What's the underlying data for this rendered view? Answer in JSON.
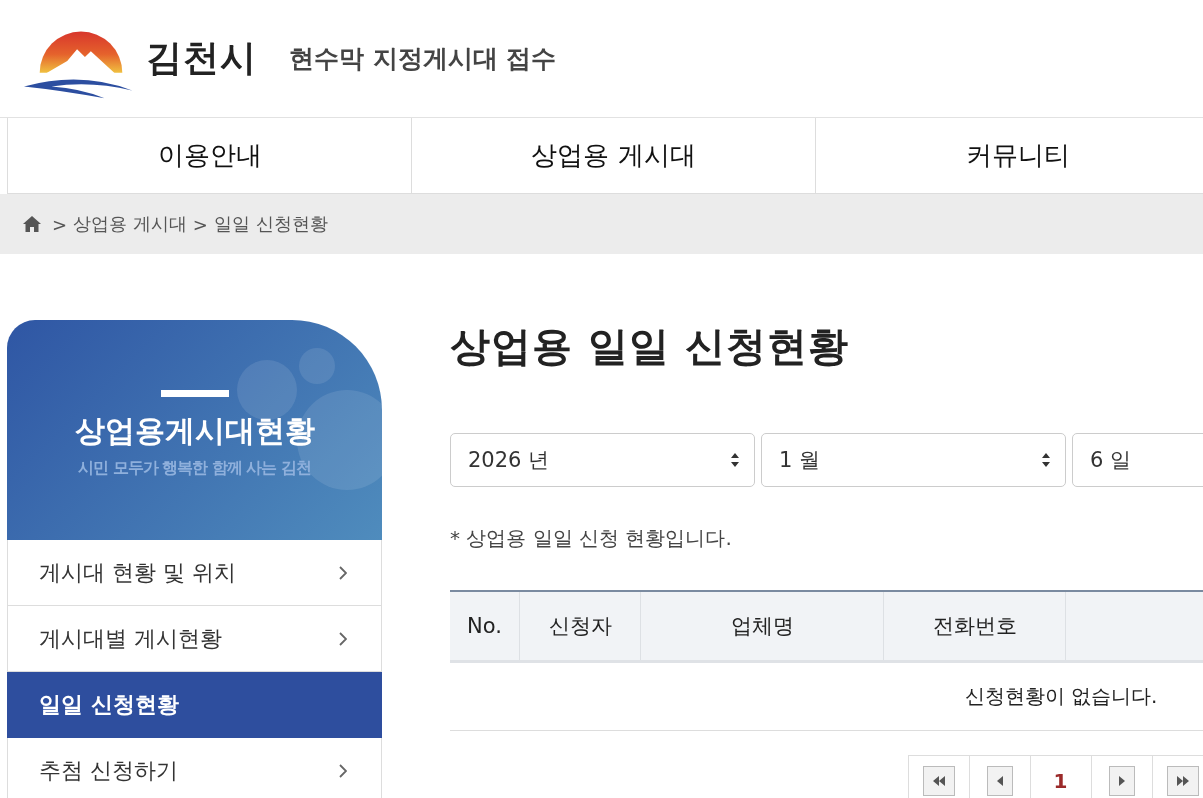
{
  "header": {
    "logo_text": "김천시",
    "site_title": "현수막 지정게시대 접수"
  },
  "nav": [
    {
      "label": "이용안내"
    },
    {
      "label": "상업용 게시대"
    },
    {
      "label": "커뮤니티"
    }
  ],
  "breadcrumb": {
    "separator": ">",
    "items": [
      "상업용 게시대",
      "일일 신청현황"
    ]
  },
  "sidebar": {
    "banner_title": "상업용게시대현황",
    "banner_subtitle": "시민 모두가 행복한 함께 사는 김천",
    "items": [
      {
        "label": "게시대 현황 및 위치",
        "selected": false
      },
      {
        "label": "게시대별 게시현황",
        "selected": false
      },
      {
        "label": "일일 신청현황",
        "selected": true
      },
      {
        "label": "추첨 신청하기",
        "selected": false
      }
    ]
  },
  "page_title": "상업용 일일 신청현황",
  "date_selects": [
    {
      "value": "2026 년"
    },
    {
      "value": "1 월"
    },
    {
      "value": "6 일"
    }
  ],
  "note": "* 상업용 일일 신청 현황입니다.",
  "table": {
    "columns": [
      "No.",
      "신청자",
      "업체명",
      "전화번호"
    ],
    "empty_message": "신청현황이 없습니다."
  },
  "pagination": [
    {
      "kind": "first"
    },
    {
      "kind": "prev"
    },
    {
      "kind": "page",
      "label": "1",
      "selected": true
    },
    {
      "kind": "next"
    },
    {
      "kind": "last"
    }
  ]
}
